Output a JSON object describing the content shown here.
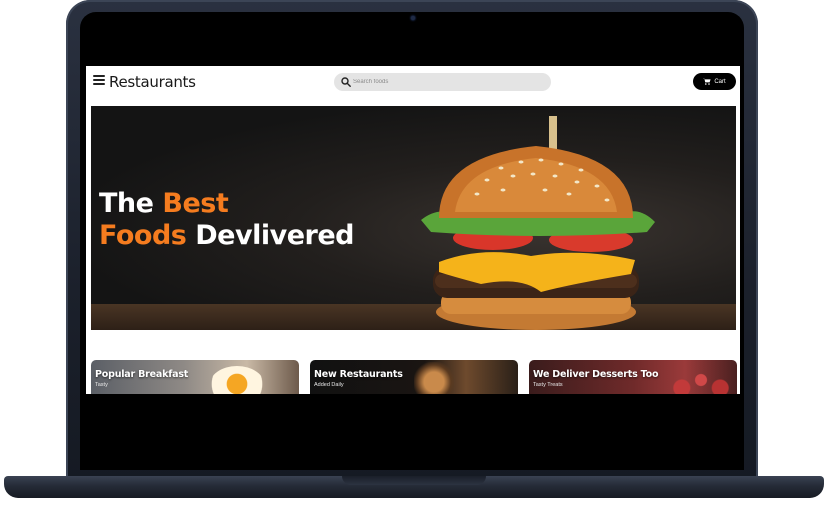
{
  "navbar": {
    "brand": "Restaurants",
    "search_placeholder": "Search foods",
    "cart_label": "Cart"
  },
  "hero": {
    "line1_white": "The ",
    "line1_accent": "Best",
    "line2_accent": "Foods",
    "line2_white": " Devlivered",
    "accent_color": "#f57c1f"
  },
  "cards": [
    {
      "title": "Popular Breakfast",
      "subtitle": "Tasty"
    },
    {
      "title": "New Restaurants",
      "subtitle": "Added Daily"
    },
    {
      "title": "We Deliver Desserts Too",
      "subtitle": "Tasty Treats"
    }
  ],
  "icons": {
    "menu": "hamburger-menu-icon",
    "search": "search-icon",
    "cart": "shopping-cart-icon"
  }
}
